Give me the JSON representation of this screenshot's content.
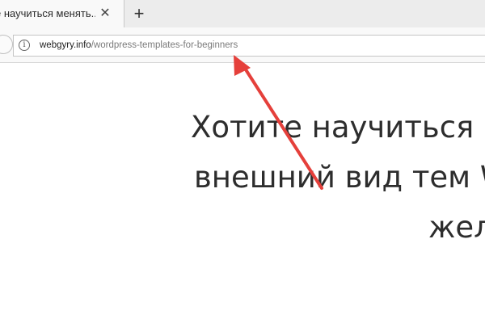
{
  "browser": {
    "tab": {
      "title": "е научиться менять...",
      "close_glyph": "✕"
    },
    "new_tab_glyph": "+",
    "address_bar": {
      "info_glyph": "i",
      "domain": "webgyry.info",
      "path": "/wordpress-templates-for-beginners"
    }
  },
  "page": {
    "heading_lines": [
      "Хотите научиться м",
      "внешний вид тем W",
      "жел"
    ]
  },
  "annotation": {
    "arrow_color": "#e5403b"
  }
}
